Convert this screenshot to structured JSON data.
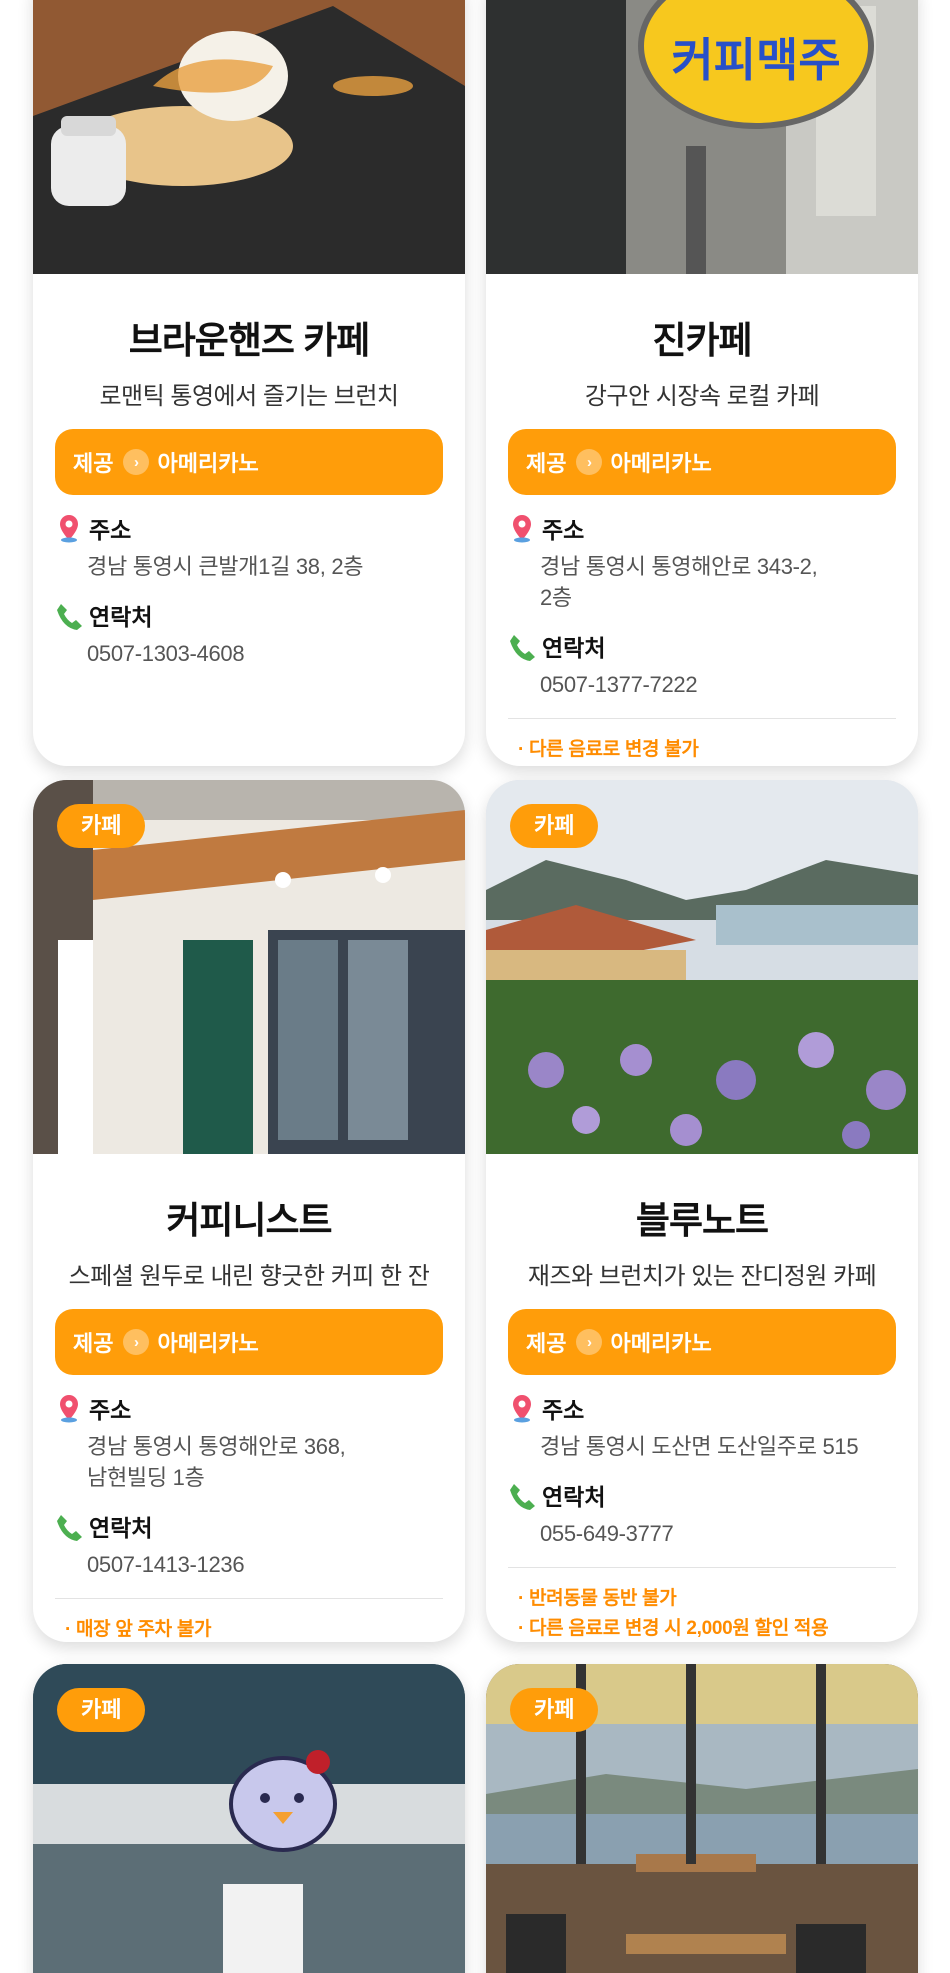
{
  "cards": [
    {
      "category": "",
      "title": "브라운핸즈 카페",
      "subtitle": "로맨틱 통영에서 즐기는 브런치",
      "provide_label": "제공",
      "provide_item": "아메리카노",
      "address_label": "주소",
      "address": "경남 통영시 큰발개1길 38, 2층",
      "phone_label": "연락처",
      "phone": "0507-1303-4608",
      "notes": []
    },
    {
      "category": "",
      "title": "진카페",
      "subtitle": "강구안 시장속 로컬 카페",
      "provide_label": "제공",
      "provide_item": "아메리카노",
      "address_label": "주소",
      "address_lines": [
        "경남 통영시 통영해안로 343-2,",
        "2층"
      ],
      "phone_label": "연락처",
      "phone": "0507-1377-7222",
      "notes": [
        "· 다른 음료로 변경 불가"
      ],
      "sign_text": "커피맥주"
    },
    {
      "category": "카페",
      "title": "커피니스트",
      "subtitle": "스페셜 원두로 내린 향긋한 커피 한 잔",
      "provide_label": "제공",
      "provide_item": "아메리카노",
      "address_label": "주소",
      "address_lines": [
        "경남 통영시 통영해안로 368,",
        "남현빌딩 1층"
      ],
      "phone_label": "연락처",
      "phone": "0507-1413-1236",
      "notes": [
        "· 매장 앞 주차 불가"
      ]
    },
    {
      "category": "카페",
      "title": "블루노트",
      "subtitle": "재즈와 브런치가 있는 잔디정원 카페",
      "provide_label": "제공",
      "provide_item": "아메리카노",
      "address_label": "주소",
      "address": "경남 통영시 도산면 도산일주로 515",
      "phone_label": "연락처",
      "phone": "055-649-3777",
      "notes": [
        "· 반려동물 동반 불가",
        "· 다른 음료로 변경 시 2,000원 할인 적용"
      ]
    },
    {
      "category": "카페"
    },
    {
      "category": "카페"
    }
  ],
  "icons": {
    "location": "map-pin-icon",
    "phone": "phone-icon",
    "arrow": "chevron-right-circle-icon"
  },
  "colors": {
    "accent": "#ff9d0a",
    "note": "#ff8c00",
    "pin": "#f0506e",
    "phone": "#4caf50"
  }
}
